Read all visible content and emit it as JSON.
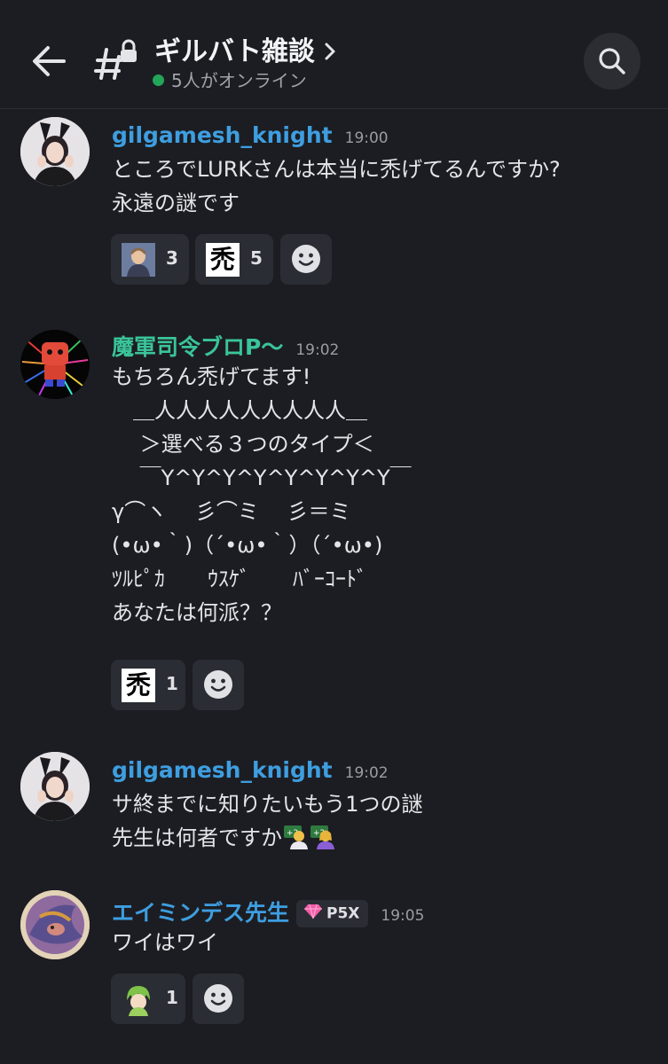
{
  "header": {
    "title": "ギルバト雑談",
    "online_text": "5人がオンライン"
  },
  "colors": {
    "background": "#1c1d22",
    "author_blue": "#3e9ee0",
    "author_green": "#3ac49a",
    "online_dot": "#23a55a"
  },
  "messages": [
    {
      "author": "gilgamesh_knight",
      "time": "19:00",
      "author_color": "#3e9ee0",
      "lines": [
        "ところでLURKさんは本当に禿げてるんですか?",
        "永遠の謎です"
      ],
      "reactions": [
        {
          "emoji": "portrait-emoji",
          "count": "3"
        },
        {
          "emoji": "禿",
          "count": "5"
        }
      ]
    },
    {
      "author": "魔軍司令ブロP〜",
      "time": "19:02",
      "author_color": "#3ac49a",
      "lines": [
        "もちろん禿げてます!",
        "　＿人人人人人人人人人＿",
        "　 ＞選べる３つのタイプ＜",
        "　 ￣Y^Y^Y^Y^Y^Y^Y^Y￣",
        "γ⌒ヽ　 彡⌒ミ　 彡＝ミ",
        "(•ω•｀)（´•ω•｀）（´•ω•)",
        "ﾂﾙﾋﾟｶ　　ｳｽｹﾞ　　ﾊﾞｰｺｰﾄﾞ",
        "あなたは何派？？"
      ],
      "reactions": [
        {
          "emoji": "禿",
          "count": "1"
        }
      ]
    },
    {
      "author": "gilgamesh_knight",
      "time": "19:02",
      "author_color": "#3e9ee0",
      "lines": [
        "サ終までに知りたいもう1つの謎",
        "先生は何者ですか"
      ],
      "inline_emojis": [
        "teacher-emoji",
        "teacher-emoji"
      ]
    },
    {
      "author": "エイミンデス先生",
      "time": "19:05",
      "author_color": "#3e9ee0",
      "badge": "P5X",
      "lines": [
        "ワイはワイ"
      ],
      "reactions": [
        {
          "emoji": "character-emoji",
          "count": "1"
        }
      ]
    }
  ]
}
